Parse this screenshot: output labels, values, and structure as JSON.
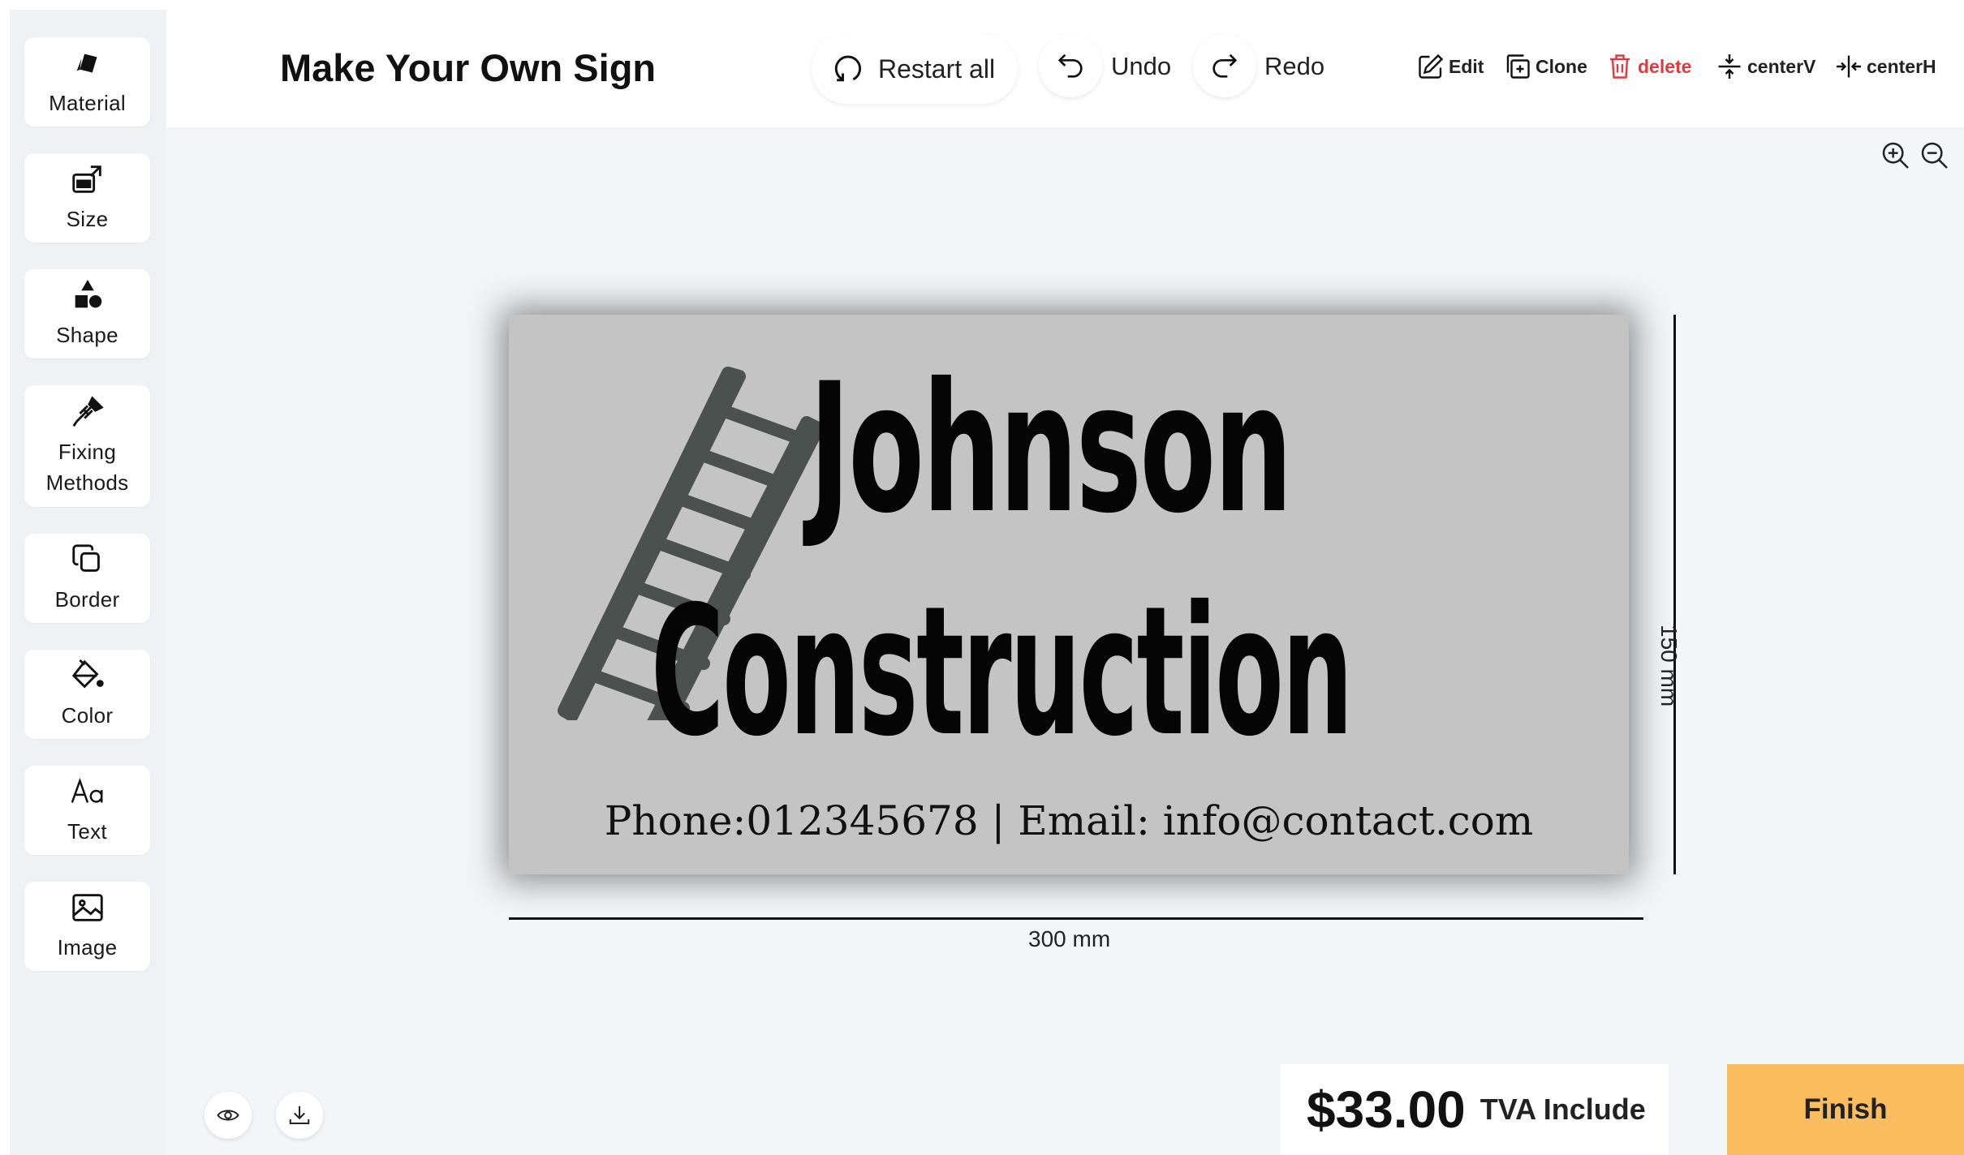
{
  "app": {
    "title": "Make Your Own Sign"
  },
  "sidebar": {
    "items": [
      {
        "label": "Material",
        "icon": "material-icon"
      },
      {
        "label": "Size",
        "icon": "size-icon"
      },
      {
        "label": "Shape",
        "icon": "shape-icon"
      },
      {
        "label": "Fixing Methods",
        "icon": "screw-icon"
      },
      {
        "label": "Border",
        "icon": "border-icon"
      },
      {
        "label": "Color",
        "icon": "paint-bucket-icon"
      },
      {
        "label": "Text",
        "icon": "text-icon"
      },
      {
        "label": "Image",
        "icon": "image-icon"
      }
    ]
  },
  "toolbar": {
    "restart_label": "Restart all",
    "undo_label": "Undo",
    "redo_label": "Redo",
    "edit_label": "Edit",
    "clone_label": "Clone",
    "delete_label": "delete",
    "centerv_label": "centerV",
    "centerh_label": "centerH"
  },
  "sign": {
    "line1": "Johnson",
    "line2": "Construction",
    "contact": "Phone:012345678 | Email: info@contact.com",
    "background_color": "#c4c4c4",
    "text_color": "#050505",
    "ladder_color": "#4b514e"
  },
  "dimensions": {
    "width_label": "300 mm",
    "height_label": "150 mm"
  },
  "footer": {
    "price": "$33.00",
    "tax_label": "TVA Include",
    "finish_label": "Finish"
  },
  "colors": {
    "accent": "#fbbd5e",
    "delete": "#e0393e",
    "canvas_bg": "#f3f6f9"
  }
}
